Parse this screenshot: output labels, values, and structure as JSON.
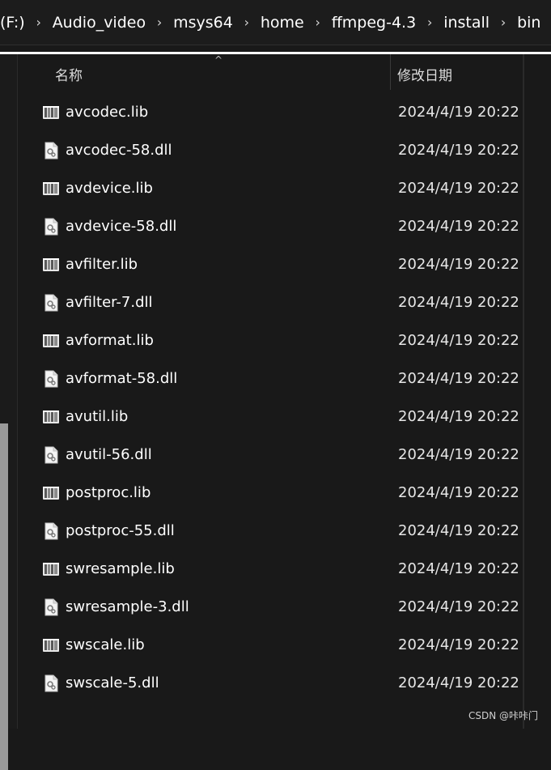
{
  "breadcrumb": {
    "drive": "(F:)",
    "items": [
      "Audio_video",
      "msys64",
      "home",
      "ffmpeg-4.3",
      "install",
      "bin"
    ],
    "separator": "›"
  },
  "columns": {
    "name": "名称",
    "modified": "修改日期",
    "sort_indicator": "^"
  },
  "files": [
    {
      "name": "avcodec.lib",
      "modified": "2024/4/19 20:22",
      "icon": "lib-file-icon"
    },
    {
      "name": "avcodec-58.dll",
      "modified": "2024/4/19 20:22",
      "icon": "dll-file-icon"
    },
    {
      "name": "avdevice.lib",
      "modified": "2024/4/19 20:22",
      "icon": "lib-file-icon"
    },
    {
      "name": "avdevice-58.dll",
      "modified": "2024/4/19 20:22",
      "icon": "dll-file-icon"
    },
    {
      "name": "avfilter.lib",
      "modified": "2024/4/19 20:22",
      "icon": "lib-file-icon"
    },
    {
      "name": "avfilter-7.dll",
      "modified": "2024/4/19 20:22",
      "icon": "dll-file-icon"
    },
    {
      "name": "avformat.lib",
      "modified": "2024/4/19 20:22",
      "icon": "lib-file-icon"
    },
    {
      "name": "avformat-58.dll",
      "modified": "2024/4/19 20:22",
      "icon": "dll-file-icon"
    },
    {
      "name": "avutil.lib",
      "modified": "2024/4/19 20:22",
      "icon": "lib-file-icon"
    },
    {
      "name": "avutil-56.dll",
      "modified": "2024/4/19 20:22",
      "icon": "dll-file-icon"
    },
    {
      "name": "postproc.lib",
      "modified": "2024/4/19 20:22",
      "icon": "lib-file-icon"
    },
    {
      "name": "postproc-55.dll",
      "modified": "2024/4/19 20:22",
      "icon": "dll-file-icon"
    },
    {
      "name": "swresample.lib",
      "modified": "2024/4/19 20:22",
      "icon": "lib-file-icon"
    },
    {
      "name": "swresample-3.dll",
      "modified": "2024/4/19 20:22",
      "icon": "dll-file-icon"
    },
    {
      "name": "swscale.lib",
      "modified": "2024/4/19 20:22",
      "icon": "lib-file-icon"
    },
    {
      "name": "swscale-5.dll",
      "modified": "2024/4/19 20:22",
      "icon": "dll-file-icon"
    }
  ],
  "watermark": "CSDN @咔咔门",
  "colors": {
    "background": "#191919",
    "text": "#ffffff",
    "scrollbar": "#9a9a9a"
  }
}
